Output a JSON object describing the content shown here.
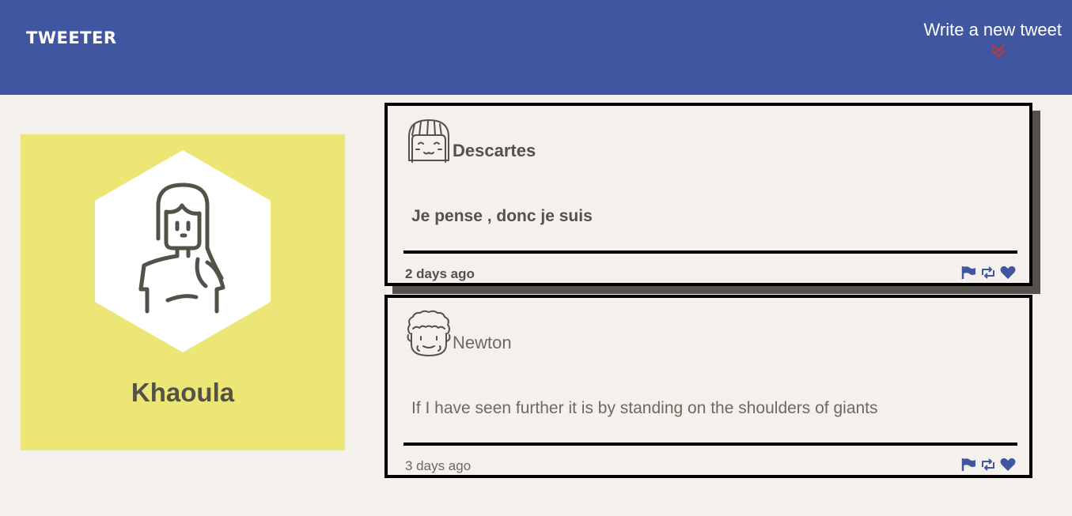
{
  "nav": {
    "brand": "TWEETER",
    "compose_label": "Write a new tweet",
    "compose_icon": "double-chevron-down-icon"
  },
  "profile": {
    "name": "Khaoula",
    "avatar_icon": "woman-avatar-icon"
  },
  "tweets": [
    {
      "author": "Descartes",
      "avatar_icon": "smiling-girl-avatar-icon",
      "text": "Je pense , donc je suis",
      "time": "2 days ago"
    },
    {
      "author": "Newton",
      "avatar_icon": "curly-hair-man-avatar-icon",
      "text": "If I have seen further it is by standing on the shoulders of giants",
      "time": "3 days ago"
    }
  ],
  "actions": [
    "flag-icon",
    "retweet-icon",
    "heart-icon"
  ],
  "colors": {
    "nav_bg": "#4056a1",
    "page_bg": "#f4f1ec",
    "profile_bg": "#ebe675",
    "text": "#545149",
    "accent": "#4056a1",
    "compose_arrow": "#c0392b"
  }
}
